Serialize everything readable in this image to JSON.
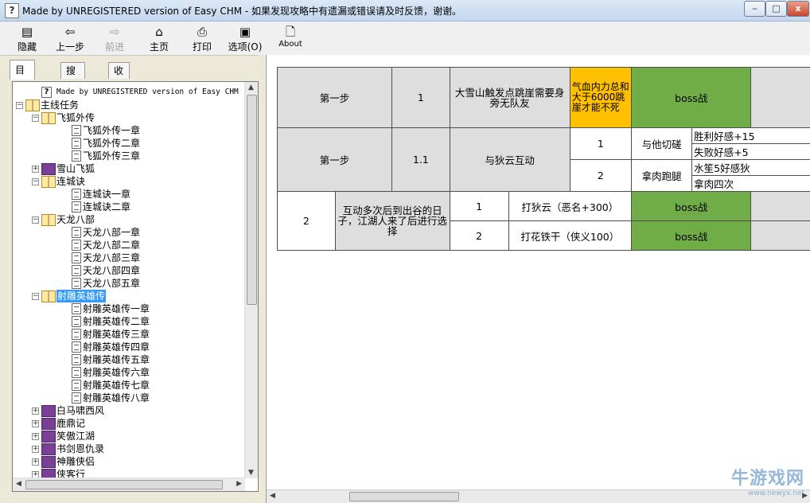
{
  "window": {
    "title": "Made by UNREGISTERED version of Easy CHM - 如果发现攻略中有遗漏或错误请及时反馈，谢谢。",
    "app_icon_glyph": "?",
    "minimize_glyph": "‒",
    "maximize_glyph": "□",
    "close_glyph": "x"
  },
  "toolbar": {
    "hide": "隐藏",
    "back": "上一步",
    "forward": "前进",
    "home": "主页",
    "print": "打印",
    "options": "选项(O)",
    "about": "About",
    "forward_disabled": true
  },
  "tabs": {
    "contents": "目录(C)",
    "search": "搜索(S)",
    "favorites": "收藏夹(I)",
    "active": "contents"
  },
  "tree": {
    "items": [
      {
        "label": "Made by UNREGISTERED version of Easy CHM",
        "icon": "help-page-icon",
        "level": 1
      },
      {
        "label": "主线任务",
        "icon": "book-open-icon",
        "level": 0,
        "expanded": true
      },
      {
        "label": "飞狐外传",
        "icon": "book-open-icon",
        "level": 1,
        "expanded": true
      },
      {
        "label": "飞狐外传一章",
        "icon": "page-icon",
        "level": 2
      },
      {
        "label": "飞狐外传二章",
        "icon": "page-icon",
        "level": 2
      },
      {
        "label": "飞狐外传三章",
        "icon": "page-icon",
        "level": 2
      },
      {
        "label": "雪山飞狐",
        "icon": "book-closed-icon",
        "level": 1,
        "expanded": false
      },
      {
        "label": "连城诀",
        "icon": "book-open-icon",
        "level": 1,
        "expanded": true
      },
      {
        "label": "连城诀一章",
        "icon": "page-icon",
        "level": 2
      },
      {
        "label": "连城诀二章",
        "icon": "page-icon",
        "level": 2
      },
      {
        "label": "天龙八部",
        "icon": "book-open-icon",
        "level": 1,
        "expanded": true
      },
      {
        "label": "天龙八部一章",
        "icon": "page-icon",
        "level": 2
      },
      {
        "label": "天龙八部二章",
        "icon": "page-icon",
        "level": 2
      },
      {
        "label": "天龙八部三章",
        "icon": "page-icon",
        "level": 2
      },
      {
        "label": "天龙八部四章",
        "icon": "page-icon",
        "level": 2
      },
      {
        "label": "天龙八部五章",
        "icon": "page-icon",
        "level": 2
      },
      {
        "label": "射雕英雄传",
        "icon": "book-open-icon",
        "level": 1,
        "expanded": true,
        "selected": true
      },
      {
        "label": "射雕英雄传一章",
        "icon": "page-icon",
        "level": 2
      },
      {
        "label": "射雕英雄传二章",
        "icon": "page-icon",
        "level": 2
      },
      {
        "label": "射雕英雄传三章",
        "icon": "page-icon",
        "level": 2
      },
      {
        "label": "射雕英雄传四章",
        "icon": "page-icon",
        "level": 2
      },
      {
        "label": "射雕英雄传五章",
        "icon": "page-icon",
        "level": 2
      },
      {
        "label": "射雕英雄传六章",
        "icon": "page-icon",
        "level": 2
      },
      {
        "label": "射雕英雄传七章",
        "icon": "page-icon",
        "level": 2
      },
      {
        "label": "射雕英雄传八章",
        "icon": "page-icon",
        "level": 2
      },
      {
        "label": "白马啸西风",
        "icon": "book-closed-icon",
        "level": 1,
        "expanded": false
      },
      {
        "label": "鹿鼎记",
        "icon": "book-closed-icon",
        "level": 1,
        "expanded": false
      },
      {
        "label": "笑傲江湖",
        "icon": "book-closed-icon",
        "level": 1,
        "expanded": false
      },
      {
        "label": "书剑恩仇录",
        "icon": "book-closed-icon",
        "level": 1,
        "expanded": false
      },
      {
        "label": "神雕侠侣",
        "icon": "book-closed-icon",
        "level": 1,
        "expanded": false
      },
      {
        "label": "侠客行",
        "icon": "book-closed-icon",
        "level": 1,
        "expanded": false
      }
    ]
  },
  "content": {
    "row1": {
      "step": "第一步",
      "num": "1",
      "desc": "大雪山触发点跳崖需要身旁无队友",
      "condition": "气血内力总和大于6000跳崖才能不死",
      "result": "boss战"
    },
    "row2": {
      "step": "第一步",
      "num": "1.1",
      "desc": "与狄云互动",
      "opt1_num": "1",
      "opt1_action": "与他切磋",
      "opt1_win": "胜利好感+15",
      "opt1_lose": "失败好感+5",
      "opt2_num": "2",
      "opt2_action": "拿肉跑腿",
      "opt2_a": "水笙5好感狄",
      "opt2_b": "拿肉四次"
    },
    "row3": {
      "num": "2",
      "desc": "互动多次后到出谷的日子，江湖人来了后进行选择",
      "opt1_num": "1",
      "opt1_action": "打狄云（恶名+300）",
      "opt1_result": "boss战",
      "opt2_num": "2",
      "opt2_action": "打花铁干（侠义100）",
      "opt2_result": "boss战"
    }
  },
  "watermark": {
    "main": "牛游戏网",
    "sub": "www.newyx.net"
  },
  "colors": {
    "orange_cell": "#ffc000",
    "green_cell": "#70ad47",
    "gray_cell": "#dedede",
    "selection": "#3399ff"
  }
}
